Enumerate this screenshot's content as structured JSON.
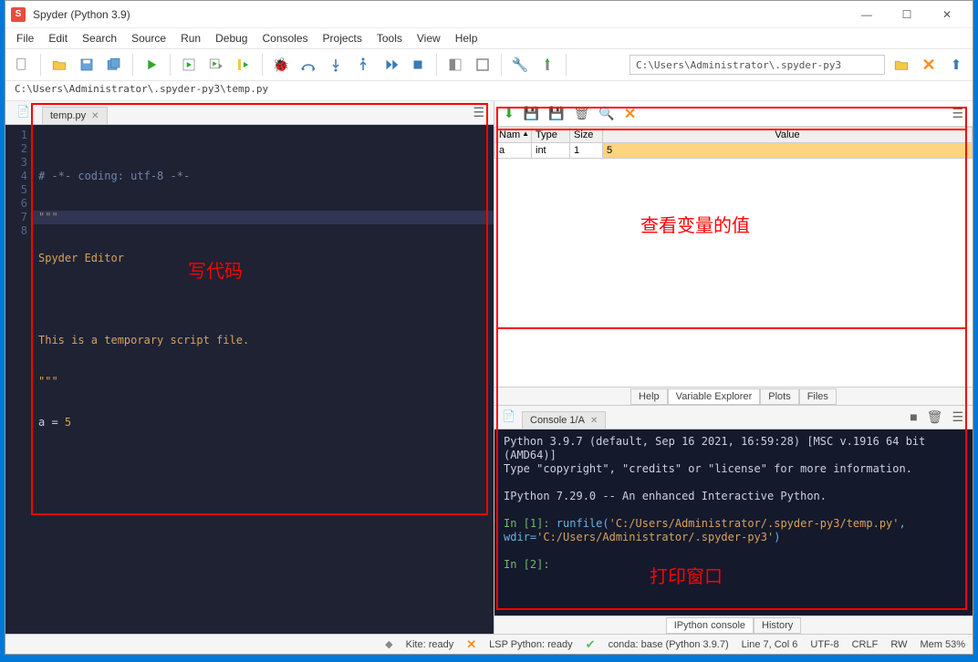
{
  "window": {
    "title": "Spyder (Python 3.9)"
  },
  "menu": {
    "file": "File",
    "edit": "Edit",
    "search": "Search",
    "source": "Source",
    "run": "Run",
    "debug": "Debug",
    "consoles": "Consoles",
    "projects": "Projects",
    "tools": "Tools",
    "view": "View",
    "help": "Help"
  },
  "toolbar": {
    "cwd": "C:\\Users\\Administrator\\.spyder-py3"
  },
  "pathbar": "C:\\Users\\Administrator\\.spyder-py3\\temp.py",
  "editor": {
    "tab": "temp.py",
    "lines": {
      "l1": "# -*- coding: utf-8 -*-",
      "l2": "\"\"\"",
      "l3": "Spyder Editor",
      "l4": "",
      "l5": "This is a temporary script file.",
      "l6": "\"\"\"",
      "l7_var": "a",
      "l7_op": " = ",
      "l7_num": "5"
    },
    "gutters": [
      "1",
      "2",
      "3",
      "4",
      "5",
      "6",
      "7",
      "8"
    ]
  },
  "variable_explorer": {
    "headers": {
      "name": "Nam",
      "type": "Type",
      "size": "Size",
      "value": "Value"
    },
    "row": {
      "name": "a",
      "type": "int",
      "size": "1",
      "value": "5"
    }
  },
  "right_top_tabs": {
    "help": "Help",
    "ve": "Variable Explorer",
    "plots": "Plots",
    "files": "Files"
  },
  "console": {
    "tab": "Console 1/A",
    "line1": "Python 3.9.7 (default, Sep 16 2021, 16:59:28) [MSC v.1916 64 bit (AMD64)]",
    "line2": "Type \"copyright\", \"credits\" or \"license\" for more information.",
    "line3": "IPython 7.29.0 -- An enhanced Interactive Python.",
    "in1": "In [1]:",
    "runfile": " runfile(",
    "arg1": "'C:/Users/Administrator/.spyder-py3/temp.py'",
    "comma": ", wdir=",
    "arg2": "'C:/Users/Administrator/.spyder-py3'",
    "close": ")",
    "in2": "In [2]:"
  },
  "right_bottom_tabs": {
    "ipy": "IPython console",
    "hist": "History"
  },
  "status": {
    "kite": "Kite: ready",
    "lsp": "LSP Python: ready",
    "conda": "conda: base (Python 3.9.7)",
    "pos": "Line 7, Col 6",
    "enc": "UTF-8",
    "eol": "CRLF",
    "rw": "RW",
    "mem": "Mem 53%"
  },
  "annotations": {
    "editor": "写代码",
    "ve": "查看变量的值",
    "console": "打印窗口"
  }
}
